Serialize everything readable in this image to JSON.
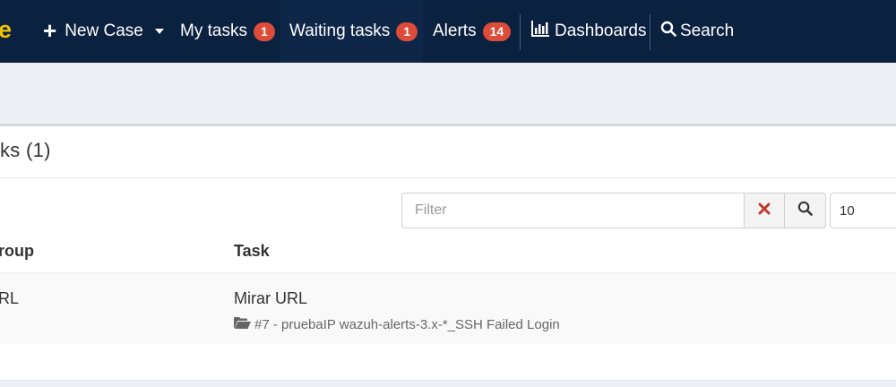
{
  "navbar": {
    "brand_fragment": "e",
    "new_case": "New Case",
    "my_tasks": {
      "label": "My tasks",
      "count": "1"
    },
    "waiting_tasks": {
      "label": "Waiting tasks",
      "count": "1"
    },
    "alerts": {
      "label": "Alerts",
      "count": "14"
    },
    "dashboards": "Dashboards",
    "search": "Search"
  },
  "box": {
    "title": "ks (1)"
  },
  "filter": {
    "placeholder": "Filter",
    "page_size": "10"
  },
  "table": {
    "headers": {
      "group": "roup",
      "task": "Task"
    },
    "rows": [
      {
        "group": "RL",
        "task": "Mirar URL",
        "case": "#7 - pruebaIP wazuh-alerts-3.x-*_SSH Failed Login"
      }
    ]
  },
  "colors": {
    "navbar_bg": "#0b2140",
    "badge": "#dd4b39",
    "brand": "#f2c400",
    "clear_icon": "#c0392b"
  },
  "icons": [
    "plus-icon",
    "caret-down-icon",
    "bar-chart-icon",
    "search-icon",
    "times-icon",
    "folder-open-icon"
  ]
}
